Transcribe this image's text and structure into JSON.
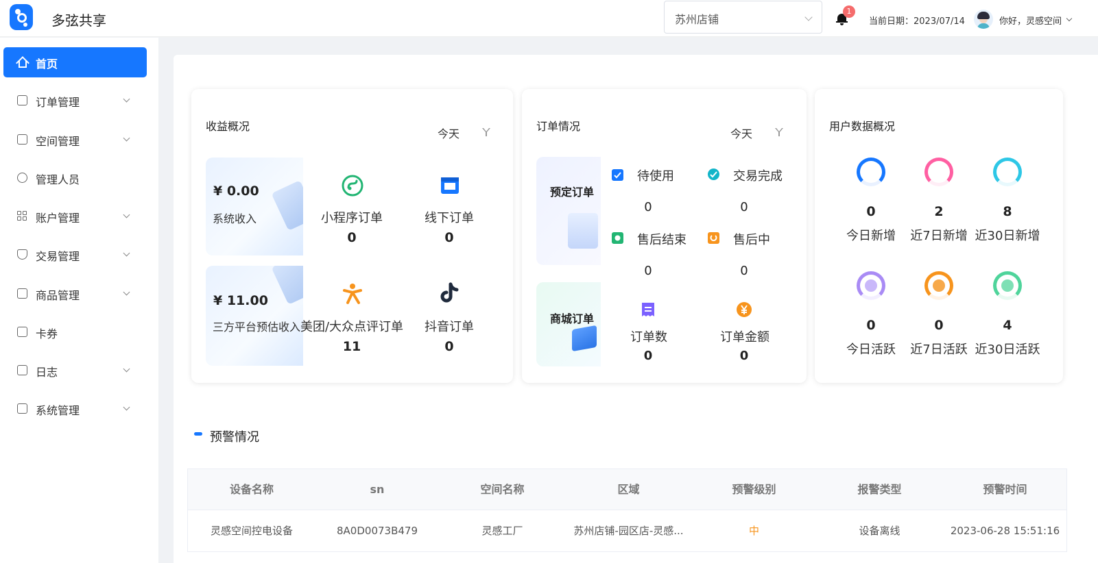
{
  "app": {
    "title": "多弦共享",
    "brand_color": "#1677ff"
  },
  "header": {
    "store_select": {
      "value": "苏州店铺"
    },
    "notifications": {
      "badge": "1"
    },
    "current_date_label": "当前日期：2023/07/14",
    "greeting": "你好，灵感空间"
  },
  "sidebar": {
    "items": [
      {
        "label": "首页",
        "icon": "home-icon",
        "active": true
      },
      {
        "label": "订单管理",
        "icon": "order-icon",
        "has_children": true
      },
      {
        "label": "空间管理",
        "icon": "space-icon",
        "has_children": true
      },
      {
        "label": "管理人员",
        "icon": "user-icon"
      },
      {
        "label": "账户管理",
        "icon": "grid-icon",
        "has_children": true
      },
      {
        "label": "交易管理",
        "icon": "shield-icon",
        "has_children": true
      },
      {
        "label": "商品管理",
        "icon": "bag-icon",
        "has_children": true
      },
      {
        "label": "卡券",
        "icon": "coupon-icon"
      },
      {
        "label": "日志",
        "icon": "log-icon",
        "has_children": true
      },
      {
        "label": "系统管理",
        "icon": "system-icon",
        "has_children": true
      }
    ]
  },
  "revenue": {
    "title": "收益概况",
    "period": "今天",
    "system_income": {
      "amount": "¥ 0.00",
      "label": "系统收入"
    },
    "platform_income": {
      "amount": "¥ 11.00",
      "label": "三方平台预估收入"
    },
    "stats": [
      {
        "label": "小程序订单",
        "value": "0",
        "icon": "mini-program-icon",
        "color": "#22b573"
      },
      {
        "label": "线下订单",
        "value": "0",
        "icon": "store-icon",
        "color": "#1677ff"
      },
      {
        "label": "美团/大众点评订单",
        "value": "11",
        "icon": "meituan-icon",
        "color": "#f7941d"
      },
      {
        "label": "抖音订单",
        "value": "0",
        "icon": "douyin-icon",
        "color": "#1f2a3c"
      }
    ]
  },
  "orders": {
    "title": "订单情况",
    "period": "今天",
    "booking_label": "预定订单",
    "mall_label": "商城订单",
    "booking_stats": [
      {
        "label": "待使用",
        "value": "0",
        "color": "#1677ff"
      },
      {
        "label": "交易完成",
        "value": "0",
        "color": "#13b5c9"
      },
      {
        "label": "售后结束",
        "value": "0",
        "color": "#22b573"
      },
      {
        "label": "售后中",
        "value": "0",
        "color": "#f7941d"
      }
    ],
    "mall_stats": [
      {
        "label": "订单数",
        "value": "0",
        "color": "#7b61ff"
      },
      {
        "label": "订单金额",
        "value": "0",
        "color": "#f7941d"
      }
    ]
  },
  "users": {
    "title": "用户数据概况",
    "new_stats": [
      {
        "label": "今日新增",
        "value": "0",
        "color": "#1677ff"
      },
      {
        "label": "近7日新增",
        "value": "2",
        "color": "#ff5fa2"
      },
      {
        "label": "近30日新增",
        "value": "8",
        "color": "#2ec7e6"
      }
    ],
    "active_stats": [
      {
        "label": "今日活跃",
        "value": "0",
        "color": "#a98bf5"
      },
      {
        "label": "近7日活跃",
        "value": "0",
        "color": "#f7941d"
      },
      {
        "label": "近30日活跃",
        "value": "4",
        "color": "#4fd49b"
      }
    ]
  },
  "warnings": {
    "title": "预警情况",
    "columns": [
      "设备名称",
      "sn",
      "空间名称",
      "区域",
      "预警级别",
      "报警类型",
      "预警时间"
    ],
    "rows": [
      [
        "灵感空间控电设备",
        "8A0D0073B479",
        "灵感工厂",
        "苏州店铺-园区店-灵感...",
        "中",
        "设备离线",
        "2023-06-28 15:51:16"
      ]
    ]
  }
}
